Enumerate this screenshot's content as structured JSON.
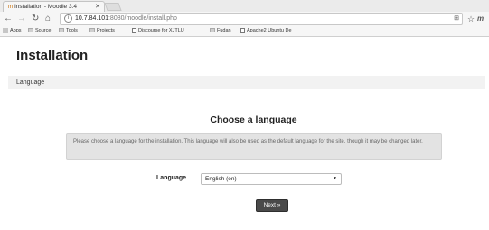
{
  "browser": {
    "tab_title": "Installation - Moodle 3.4",
    "url_host": "10.7.84.101",
    "url_port": ":8080",
    "url_path": "/moodle/install.php",
    "bookmarks": [
      {
        "label": "Apps",
        "icon": "apps-grid-icon"
      },
      {
        "label": "Source",
        "icon": "folder-icon"
      },
      {
        "label": "Tools",
        "icon": "folder-icon"
      },
      {
        "label": "Projects",
        "icon": "folder-icon"
      },
      {
        "label": "Discourse for XJTLU",
        "icon": "page-icon"
      },
      {
        "label": "Fudan",
        "icon": "folder-icon"
      },
      {
        "label": "Apache2 Ubuntu De",
        "icon": "page-icon"
      }
    ]
  },
  "page": {
    "title": "Installation",
    "breadcrumb": "Language",
    "heading": "Choose a language",
    "notice": "Please choose a language for the installation. This language will also be used as the default language for the site, though it may be changed later.",
    "language_label": "Language",
    "language_selected": "English (en)",
    "next_label": "Next »"
  }
}
